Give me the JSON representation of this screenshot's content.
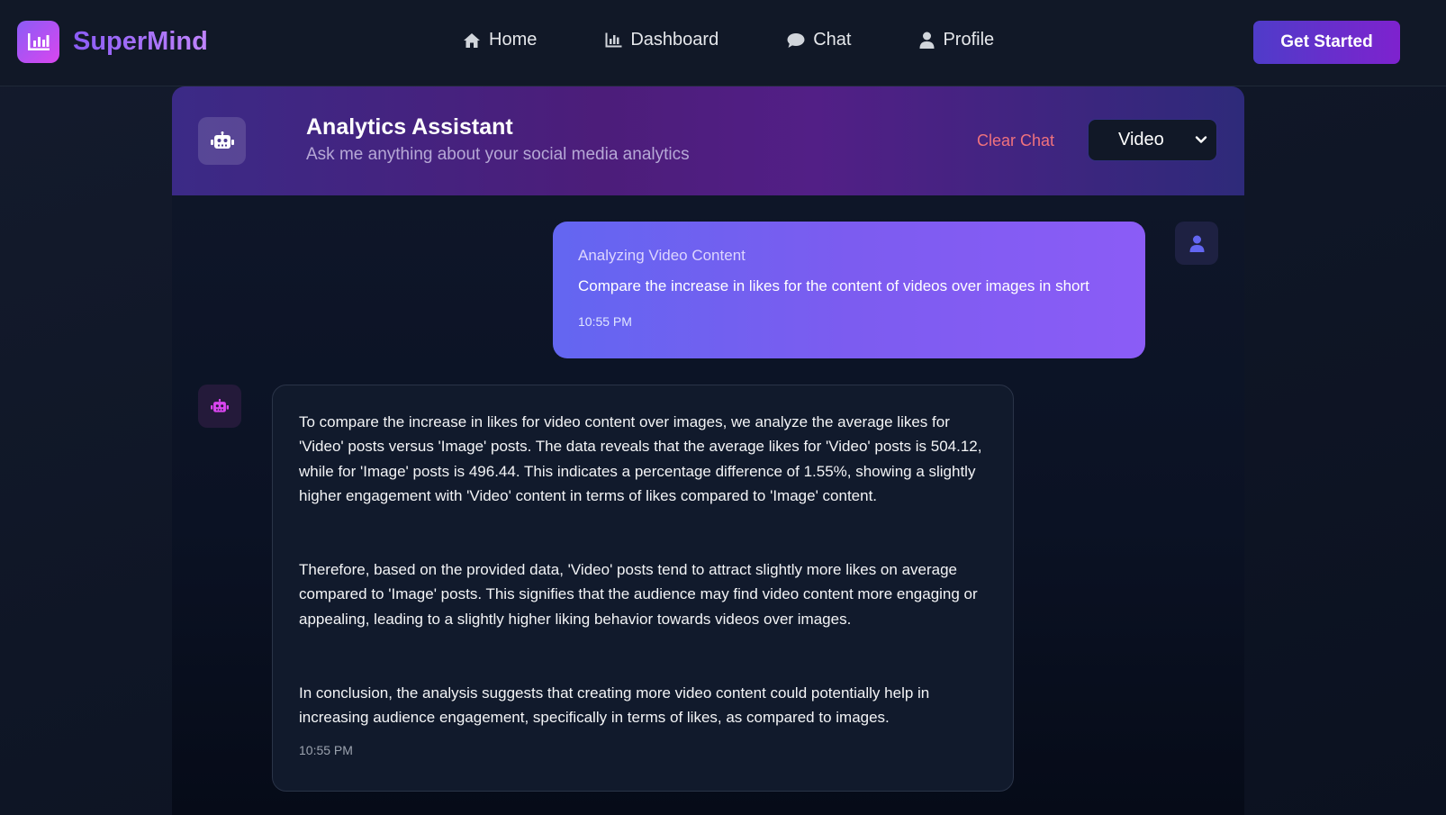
{
  "brand": {
    "name": "SuperMind",
    "logo_icon": "bar-chart-icon"
  },
  "nav": {
    "items": [
      {
        "label": "Home",
        "icon": "home-icon"
      },
      {
        "label": "Dashboard",
        "icon": "chart-icon"
      },
      {
        "label": "Chat",
        "icon": "chat-bubble-icon"
      },
      {
        "label": "Profile",
        "icon": "user-icon"
      }
    ],
    "cta_label": "Get Started"
  },
  "chat_header": {
    "title": "Analytics Assistant",
    "subtitle": "Ask me anything about your social media analytics",
    "clear_label": "Clear Chat",
    "content_type_selected": "Video"
  },
  "messages": {
    "user": {
      "title": "Analyzing Video Content",
      "text": "Compare the increase in likes for the content of videos over images in short",
      "time": "10:55 PM"
    },
    "bot": {
      "paragraphs": [
        "To compare the increase in likes for video content over images, we analyze the average likes for 'Video' posts versus 'Image' posts. The data reveals that the average likes for 'Video' posts is 504.12, while for 'Image' posts is 496.44. This indicates a percentage difference of 1.55%, showing a slightly higher engagement with 'Video' content in terms of likes compared to 'Image' content.",
        "Therefore, based on the provided data, 'Video' posts tend to attract slightly more likes on average compared to 'Image' posts. This signifies that the audience may find video content more engaging or appealing, leading to a slightly higher liking behavior towards videos over images.",
        "In conclusion, the analysis suggests that creating more video content could potentially help in increasing audience engagement, specifically in terms of likes, as compared to images."
      ],
      "time": "10:55 PM"
    }
  },
  "colors": {
    "accent_purple": "#8b5cf6",
    "accent_pink": "#d946ef",
    "clear_chat_red": "#f0727d",
    "background": "#111827"
  }
}
